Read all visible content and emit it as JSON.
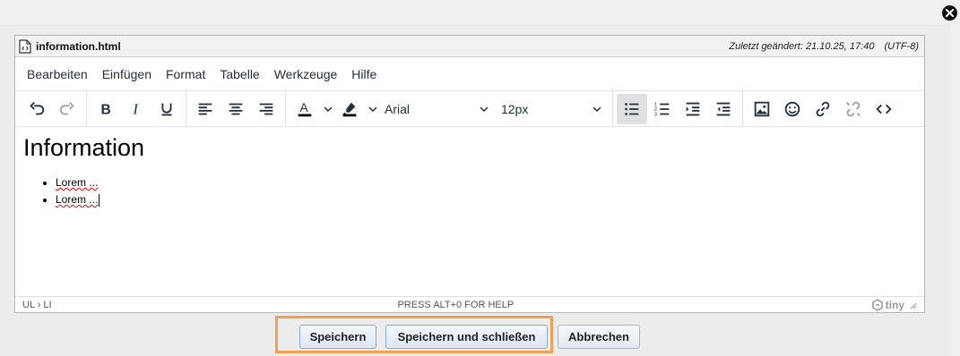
{
  "file": {
    "name": "information.html",
    "modified": "Zuletzt geändert: 21.10.25, 17:40",
    "encoding": "(UTF-8)"
  },
  "menu": [
    "Bearbeiten",
    "Einfügen",
    "Format",
    "Tabelle",
    "Werkzeuge",
    "Hilfe"
  ],
  "toolbar": {
    "font_family": "Arial",
    "font_size": "12px",
    "text_color": "#000000",
    "highlight_color": "#000000"
  },
  "content": {
    "heading": "Information",
    "items": [
      "Lorem ...",
      "Lorem ..."
    ]
  },
  "status": {
    "path": "UL › LI",
    "help": "PRESS ALT+0 FOR HELP",
    "brand": "tiny"
  },
  "buttons": {
    "save": "Speichern",
    "save_close": "Speichern und schließen",
    "cancel": "Abbrechen"
  }
}
